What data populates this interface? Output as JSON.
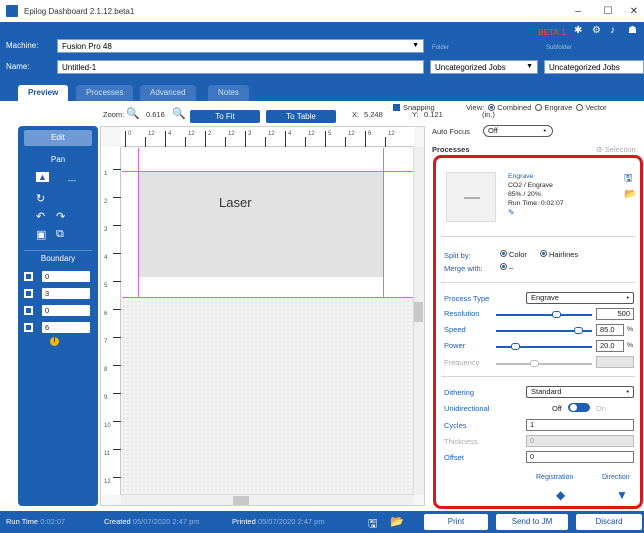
{
  "window": {
    "title": "Epilog Dashboard 2.1.12.beta1",
    "minimize": "–",
    "maximize": "☐",
    "close": "✕"
  },
  "header": {
    "machine_label": "Machine:",
    "machine_value": "Fusion Pro 48",
    "name_label": "Name:",
    "name_value": "Untitled-1",
    "folder_label": "Folder",
    "folder_value": "Uncategorized Jobs",
    "subfolder_label": "Subfolder",
    "subfolder_value": "Uncategorized Jobs",
    "beta_badge": "BETA 1",
    "accent_color": "#1d5fb0",
    "beta_color": "#e8403a"
  },
  "tabs": [
    {
      "label": "Preview"
    },
    {
      "label": "Processes"
    },
    {
      "label": "Advanced"
    },
    {
      "label": "Notes"
    }
  ],
  "options": {
    "snapping_label": "Snapping",
    "view_label": "View:",
    "view_options": [
      "Combined",
      "Engrave",
      "Vector"
    ],
    "view_selected": "Combined"
  },
  "zoom": {
    "label": "Zoom:",
    "value": "0.616",
    "to_fit": "To Fit",
    "to_table": "To Table",
    "x_label": "X:",
    "x_value": "5.248",
    "y_label": "Y:",
    "y_value": "0.121",
    "unit": "(in.)"
  },
  "tools": {
    "edit": "Edit",
    "pan": "Pan",
    "pointer_dash": "---",
    "boundary": "Boundary",
    "boundary_values": [
      "0",
      "3",
      "0",
      "6"
    ],
    "warning": "!"
  },
  "rulers": {
    "top": [
      "0",
      "12",
      "4",
      "12",
      "2",
      "12",
      "3",
      "12",
      "4",
      "12",
      "5",
      "12",
      "6",
      "12"
    ],
    "left": [
      "1",
      "2",
      "3",
      "4",
      "5",
      "6",
      "7",
      "8",
      "9",
      "10",
      "11",
      "12"
    ]
  },
  "canvas": {
    "job_text": "Laser"
  },
  "right": {
    "autofocus_label": "Auto Focus",
    "autofocus_value": "Off",
    "processes_label": "Processes",
    "selection_label": "Selection"
  },
  "process": {
    "name": "Engrave",
    "type_line": "CO2 / Engrave",
    "power_speed": "85% / 20%",
    "runtime": "Run Time: 0:02:07",
    "split_by_label": "Split by:",
    "split_color": "Color",
    "split_hairlines": "Hairlines",
    "merge_with_label": "Merge with:",
    "merge_value": "–",
    "process_type_label": "Process Type",
    "process_type_value": "Engrave",
    "resolution_label": "Resolution",
    "resolution_value": "500",
    "speed_label": "Speed",
    "speed_value": "85.0",
    "speed_unit": "%",
    "power_label": "Power",
    "power_value": "20.0",
    "power_unit": "%",
    "frequency_label": "Frequency",
    "frequency_value": "",
    "dithering_label": "Dithering",
    "dithering_value": "Standard",
    "unidirectional_label": "Unidirectional",
    "unidirectional_off": "Off",
    "unidirectional_on": "On",
    "cycles_label": "Cycles",
    "cycles_value": "1",
    "thickness_label": "Thickness",
    "thickness_value": "0",
    "offset_label": "Offset",
    "offset_value": "0",
    "registration_label": "Registration",
    "direction_label": "Direction",
    "slider_levels": {
      "resolution": 0.62,
      "speed": 0.85,
      "power": 0.2,
      "frequency": 0.4
    }
  },
  "footer": {
    "runtime_label": "Run Time",
    "runtime_value": "0:02:07",
    "created_label": "Created",
    "created_value": "05/07/2020 2:47 pm",
    "printed_label": "Printed",
    "printed_value": "05/07/2020 2:47 pm",
    "print_button": "Print",
    "send_button": "Send to JM",
    "discard_button": "Discard"
  }
}
